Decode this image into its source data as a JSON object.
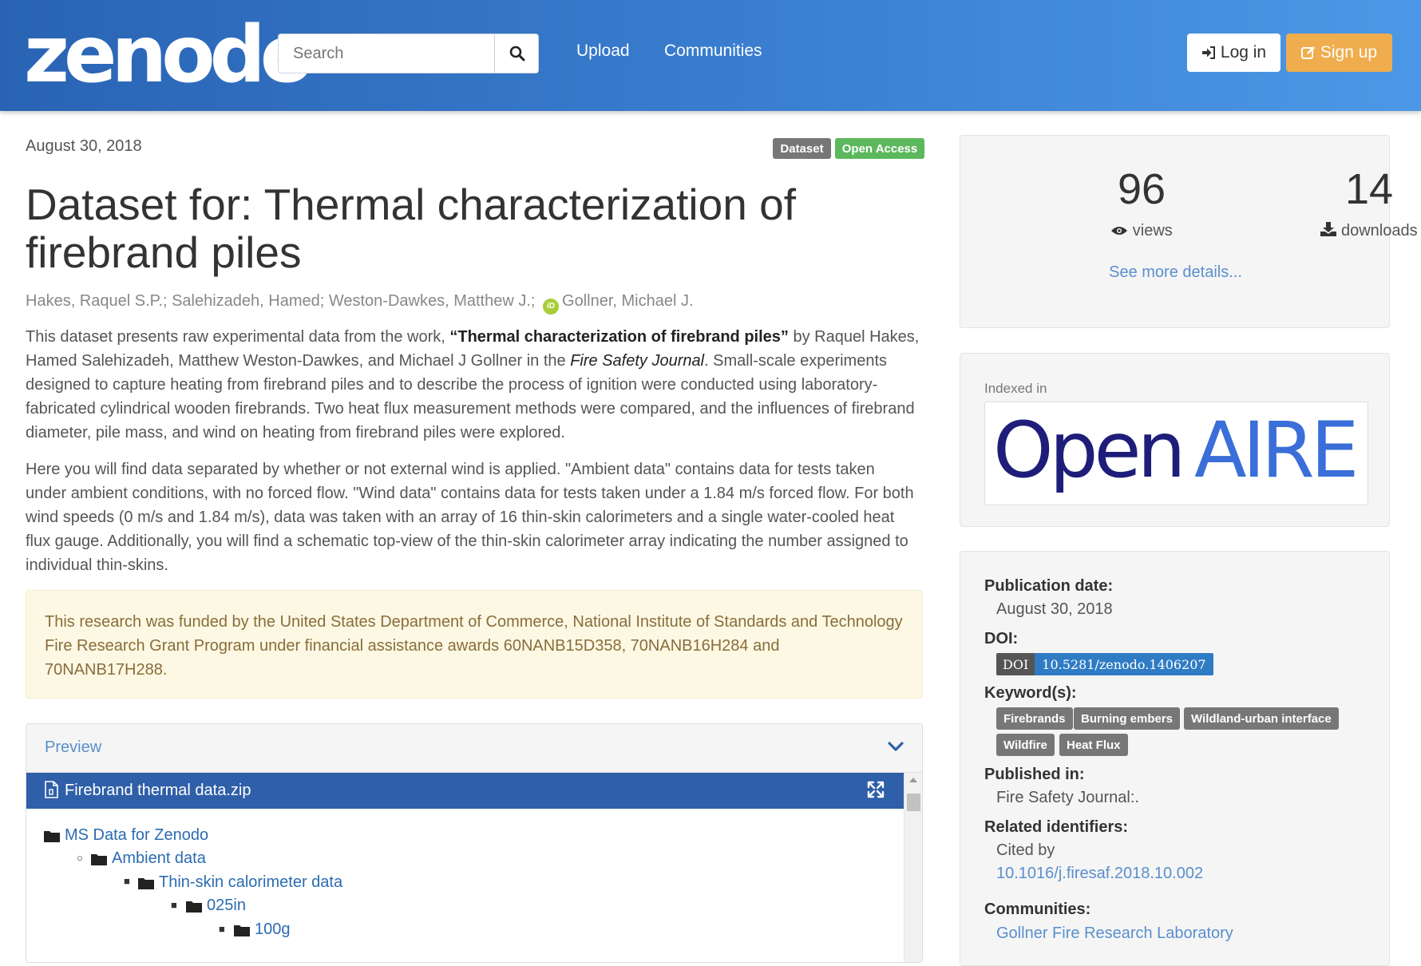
{
  "header": {
    "logo": "zenodo",
    "search_placeholder": "Search",
    "nav": [
      "Upload",
      "Communities"
    ],
    "login_label": "Log in",
    "signup_label": "Sign up",
    "icons": {
      "search": "search-icon",
      "login": "sign-in-icon",
      "signup": "edit-icon"
    }
  },
  "record": {
    "date": "August 30, 2018",
    "badges": [
      {
        "label": "Dataset",
        "color": "#777777"
      },
      {
        "label": "Open Access",
        "color": "#5cb85c"
      }
    ],
    "title": "Dataset for: Thermal characterization of firebrand piles",
    "authors": {
      "before_orcid": "Hakes, Raquel S.P.; Salehizadeh, Hamed; Weston-Dawkes, Matthew J.;",
      "orcid_icon": "iD",
      "after_orcid": "Gollner, Michael J."
    },
    "description": {
      "p1_start": "This dataset presents raw experimental data from the work, ",
      "p1_bold": "“Thermal characterization of firebrand piles”",
      "p1_mid": " by Raquel Hakes, Hamed Salehizadeh, Matthew Weston-Dawkes, and Michael J Gollner in the ",
      "p1_italic": "Fire Safety Journal",
      "p1_end": ". Small-scale experiments designed to capture heating from firebrand piles and to describe the process of ignition were conducted using laboratory-fabricated cylindrical wooden firebrands. Two heat flux measurement methods were compared, and the influences of firebrand diameter, pile mass, and wind on heating from firebrand piles were explored.",
      "p2": "Here you will find data separated by whether or not external wind is applied. \"Ambient data\" contains data for tests taken under ambient conditions, with no forced flow. \"Wind data\" contains data for tests taken under a 1.84 m/s forced flow. For both wind speeds (0 m/s and 1.84 m/s), data was taken with an array of 16 thin-skin calorimeters and a single water-cooled heat flux gauge. Additionally, you will find a schematic top-view of the thin-skin calorimeter array indicating the number assigned to individual thin-skins."
    },
    "funding": "This research was funded by the United States Department of Commerce, National Institute of Standards and Technology Fire Research Grant Program under financial assistance awards 60NANB15D358, 70NANB16H284 and 70NANB17H288."
  },
  "preview": {
    "label": "Preview",
    "file_name": "Firebrand thermal data.zip",
    "tree": [
      {
        "label": "MS Data for Zenodo",
        "level": 0
      },
      {
        "label": "Ambient data",
        "level": 1
      },
      {
        "label": "Thin-skin calorimeter data",
        "level": 2
      },
      {
        "label": "025in",
        "level": 3
      },
      {
        "label": "100g",
        "level": 4
      }
    ]
  },
  "stats": {
    "views": "96",
    "views_label": "views",
    "downloads": "14",
    "downloads_label": "downloads",
    "more_label": "See more details..."
  },
  "indexed": {
    "label": "Indexed in",
    "logo_open": "Open",
    "logo_aire": "AIRE"
  },
  "metadata": {
    "publication_date_label": "Publication date:",
    "publication_date": "August 30, 2018",
    "doi_label": "DOI:",
    "doi_key": "DOI",
    "doi_value": "10.5281/zenodo.1406207",
    "keywords_label": "Keyword(s):",
    "keywords": [
      "Firebrands",
      "Burning embers",
      "Wildland-urban interface",
      "Wildfire",
      "Heat Flux"
    ],
    "published_in_label": "Published in:",
    "published_in": "Fire Safety Journal:.",
    "related_label": "Related identifiers:",
    "related_type": "Cited by",
    "related_link": "10.1016/j.firesaf.2018.10.002",
    "communities_label": "Communities:",
    "communities": "Gollner Fire Research Laboratory"
  }
}
